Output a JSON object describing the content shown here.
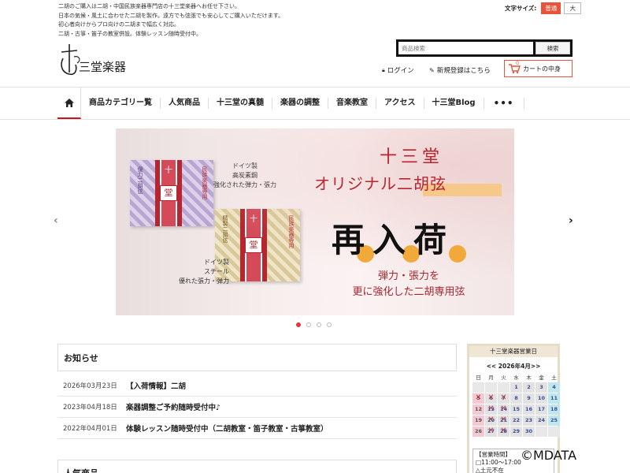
{
  "header": {
    "intro_lines": [
      "二胡のご購入は二胡・中国民族楽器専門店の十三堂楽器へお任せ下さい。",
      "日本の気候・風土に合わせた二胡を製作。遠方でも弦張でも安心してご購入いただけます。",
      "初心者向けからプロ向けの二胡まで幅広く対応。",
      "二胡・古箏・笛子の教室併設。体験レッスン随時受付中。"
    ],
    "font_size_label": "文字サイズ:",
    "font_size_normal": "普通",
    "font_size_large": "大",
    "logo_text": "三堂楽器",
    "search_placeholder": "商品検索",
    "search_button": "検索",
    "login": "ログイン",
    "register": "新規登録はこちら",
    "cart_label": "カートの中身",
    "cart_count": "0"
  },
  "nav": {
    "items": [
      "商品カテゴリー覧",
      "人気商品",
      "十三堂の真髄",
      "楽器の調整",
      "音楽教室",
      "アクセス",
      "十三堂Blog"
    ],
    "more": "•••"
  },
  "banner": {
    "brand": "十三堂",
    "headline": "オリジナル二胡弦",
    "restock": "再入荷",
    "sub_lines": [
      "弾力・張力を",
      "更に強化した二胡専用弦"
    ],
    "text_top": [
      "ドイツ製",
      "高炭素鋼",
      "強化された弾力・張力"
    ],
    "text_bottom": [
      "ドイツ製",
      "スチール",
      "優れた張力・弾力"
    ],
    "pkg1_label": "優力二胡弦",
    "pkg2_label": "精製二胡弦",
    "pkg_side": "民族楽器専用",
    "pkg_mark": "十",
    "pkg_stamp": "堂",
    "slides": 4,
    "active_slide": 1
  },
  "news": {
    "title": "お知らせ",
    "items": [
      {
        "date": "2026年03月23日",
        "title": "【入荷情報】二胡"
      },
      {
        "date": "2023年04月18日",
        "title": "楽器調整ご予約随時受付中♪"
      },
      {
        "date": "2022年04月01日",
        "title": "体験レッスン随時受付中（二胡教室・笛子教室・古箏教室）"
      }
    ]
  },
  "popular": {
    "title": "人気商品"
  },
  "calendar": {
    "title": "十三堂楽器営業日",
    "month": "<< 2026年4月>>",
    "dow": [
      "日",
      "月",
      "火",
      "水",
      "木",
      "金",
      "土"
    ],
    "weeks": [
      [
        "",
        "",
        "",
        "1",
        "2",
        "3",
        "4"
      ],
      [
        "5",
        "6",
        "7",
        "8",
        "9",
        "10",
        "11"
      ],
      [
        "12",
        "13",
        "14",
        "15",
        "16",
        "17",
        "18"
      ],
      [
        "19",
        "20",
        "21",
        "22",
        "23",
        "24",
        "25"
      ],
      [
        "26",
        "27",
        "28",
        "29",
        "30",
        "",
        ""
      ]
    ],
    "closed": [
      "5",
      "6",
      "7",
      "13",
      "14",
      "20",
      "21",
      "27",
      "28"
    ],
    "info_lines": [
      "【営業時間】",
      "□11:00～17:00",
      "△土元不在"
    ]
  },
  "watermark": "©MDATA",
  "colors": {
    "accent": "#e8543b",
    "brand_red": "#b8242f",
    "calendar_frame": "#e6dcc8"
  }
}
